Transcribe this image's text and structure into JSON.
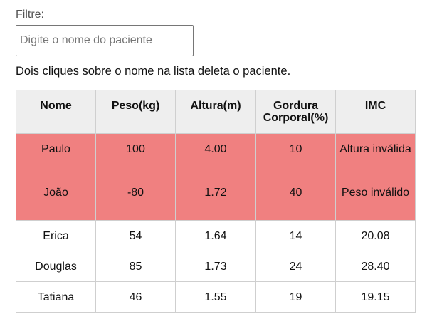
{
  "filter": {
    "label": "Filtre:",
    "placeholder": "Digite o nome do paciente",
    "value": ""
  },
  "hint": "Dois cliques sobre o nome na lista deleta o paciente.",
  "table": {
    "headers": {
      "nome": "Nome",
      "peso": "Peso(kg)",
      "altura": "Altura(m)",
      "gordura": "Gordura Corporal(%)",
      "imc": "IMC"
    },
    "rows": [
      {
        "nome": "Paulo",
        "peso": "100",
        "altura": "4.00",
        "gordura": "10",
        "imc": "Altura inválida",
        "status": "invalid"
      },
      {
        "nome": "João",
        "peso": "-80",
        "altura": "1.72",
        "gordura": "40",
        "imc": "Peso inválido",
        "status": "invalid"
      },
      {
        "nome": "Erica",
        "peso": "54",
        "altura": "1.64",
        "gordura": "14",
        "imc": "20.08",
        "status": "valid"
      },
      {
        "nome": "Douglas",
        "peso": "85",
        "altura": "1.73",
        "gordura": "24",
        "imc": "28.40",
        "status": "valid"
      },
      {
        "nome": "Tatiana",
        "peso": "46",
        "altura": "1.55",
        "gordura": "19",
        "imc": "19.15",
        "status": "valid"
      }
    ]
  },
  "colors": {
    "invalid_row": "#f08080",
    "header_bg": "#eeeeee",
    "border": "#cfcfcf"
  }
}
